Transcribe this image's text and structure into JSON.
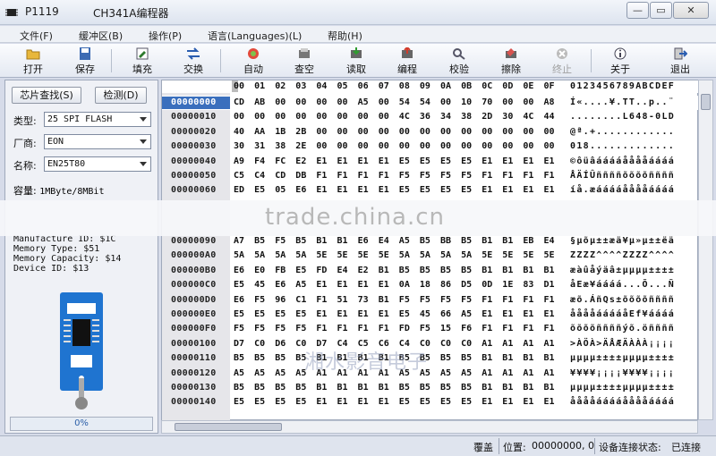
{
  "window": {
    "id": "P1119",
    "title": "CH341A编程器"
  },
  "menu": [
    "文件(F)",
    "缓冲区(B)",
    "操作(P)",
    "语言(Languages)(L)",
    "帮助(H)"
  ],
  "toolbar": [
    {
      "label": "打开",
      "icon": "open-folder-icon"
    },
    {
      "label": "保存",
      "icon": "save-icon"
    },
    {
      "label": "填充",
      "icon": "fill-icon"
    },
    {
      "label": "交换",
      "icon": "swap-icon"
    },
    {
      "label": "自动",
      "icon": "auto-icon"
    },
    {
      "label": "查空",
      "icon": "blank-check-icon"
    },
    {
      "label": "读取",
      "icon": "read-icon"
    },
    {
      "label": "编程",
      "icon": "program-icon"
    },
    {
      "label": "校验",
      "icon": "verify-icon"
    },
    {
      "label": "擦除",
      "icon": "erase-icon"
    },
    {
      "label": "终止",
      "icon": "stop-icon"
    },
    {
      "label": "关于",
      "icon": "about-icon"
    },
    {
      "label": "退出",
      "icon": "exit-icon"
    }
  ],
  "left": {
    "find_chip": "芯片查找(S)",
    "detect": "检测(D)",
    "type_label": "类型:",
    "type_value": "25 SPI FLASH",
    "vendor_label": "厂商:",
    "vendor_value": "EON",
    "name_label": "名称:",
    "name_value": "EN25T80",
    "capacity_label": "容量:",
    "capacity_value": "1MByte/8MBit",
    "info": [
      "Manufacture ID: $1C",
      "Memory Type: $51",
      "Memory Capacity: $14",
      "Device ID: $13"
    ],
    "progress": "0%"
  },
  "hex": {
    "header_cols": [
      "00",
      "01",
      "02",
      "03",
      "04",
      "05",
      "06",
      "07",
      "08",
      "09",
      "0A",
      "0B",
      "0C",
      "0D",
      "0E",
      "0F"
    ],
    "ascii_header": "0123456789ABCDEF",
    "rows_top": [
      {
        "addr": "00000000",
        "bytes": [
          "CD",
          "AB",
          "00",
          "00",
          "00",
          "00",
          "A5",
          "00",
          "54",
          "54",
          "00",
          "10",
          "70",
          "00",
          "00",
          "A8"
        ],
        "ascii": "Í«....¥.TT..p..¨"
      },
      {
        "addr": "00000010",
        "bytes": [
          "00",
          "00",
          "00",
          "00",
          "00",
          "00",
          "00",
          "00",
          "4C",
          "36",
          "34",
          "38",
          "2D",
          "30",
          "4C",
          "44"
        ],
        "ascii": "........L648-0LD"
      },
      {
        "addr": "00000020",
        "bytes": [
          "40",
          "AA",
          "1B",
          "2B",
          "00",
          "00",
          "00",
          "00",
          "00",
          "00",
          "00",
          "00",
          "00",
          "00",
          "00",
          "00"
        ],
        "ascii": "@ª.+............"
      },
      {
        "addr": "00000030",
        "bytes": [
          "30",
          "31",
          "38",
          "2E",
          "00",
          "00",
          "00",
          "00",
          "00",
          "00",
          "00",
          "00",
          "00",
          "00",
          "00",
          "00"
        ],
        "ascii": "018............."
      },
      {
        "addr": "00000040",
        "bytes": [
          "A9",
          "F4",
          "FC",
          "E2",
          "E1",
          "E1",
          "E1",
          "E1",
          "E5",
          "E5",
          "E5",
          "E5",
          "E1",
          "E1",
          "E1",
          "E1"
        ],
        "ascii": "©ôüâááááååååáááá"
      },
      {
        "addr": "00000050",
        "bytes": [
          "C5",
          "C4",
          "CD",
          "DB",
          "F1",
          "F1",
          "F1",
          "F1",
          "F5",
          "F5",
          "F5",
          "F5",
          "F1",
          "F1",
          "F1",
          "F1"
        ],
        "ascii": "ÅÄÍÛññññõõõõññññ"
      },
      {
        "addr": "00000060",
        "bytes": [
          "ED",
          "E5",
          "05",
          "E6",
          "E1",
          "E1",
          "E1",
          "E1",
          "E5",
          "E5",
          "E5",
          "E5",
          "E1",
          "E1",
          "E1",
          "E1"
        ],
        "ascii": "íå.æááááååååáááá"
      }
    ],
    "rows_bottom": [
      {
        "addr": "00000090",
        "bytes": [
          "A7",
          "B5",
          "F5",
          "B5",
          "B1",
          "B1",
          "E6",
          "E4",
          "A5",
          "B5",
          "BB",
          "B5",
          "B1",
          "B1",
          "EB",
          "E4"
        ],
        "ascii": "§µõµ±±æä¥µ»µ±±ëä"
      },
      {
        "addr": "000000A0",
        "bytes": [
          "5A",
          "5A",
          "5A",
          "5A",
          "5E",
          "5E",
          "5E",
          "5E",
          "5A",
          "5A",
          "5A",
          "5A",
          "5E",
          "5E",
          "5E",
          "5E"
        ],
        "ascii": "ZZZZ^^^^ZZZZ^^^^"
      },
      {
        "addr": "000000B0",
        "bytes": [
          "E6",
          "E0",
          "FB",
          "E5",
          "FD",
          "E4",
          "E2",
          "B1",
          "B5",
          "B5",
          "B5",
          "B5",
          "B1",
          "B1",
          "B1",
          "B1"
        ],
        "ascii": "æàûåýäâ±µµµµ±±±±"
      },
      {
        "addr": "000000C0",
        "bytes": [
          "E5",
          "45",
          "E6",
          "A5",
          "E1",
          "E1",
          "E1",
          "E1",
          "0A",
          "18",
          "86",
          "D5",
          "0D",
          "1E",
          "83",
          "D1"
        ],
        "ascii": "åEæ¥áááá...Õ...Ñ"
      },
      {
        "addr": "000000D0",
        "bytes": [
          "E6",
          "F5",
          "96",
          "C1",
          "F1",
          "51",
          "73",
          "B1",
          "F5",
          "F5",
          "F5",
          "F5",
          "F1",
          "F1",
          "F1",
          "F1"
        ],
        "ascii": "æõ.ÁñQs±õõõõññññ"
      },
      {
        "addr": "000000E0",
        "bytes": [
          "E5",
          "E5",
          "E5",
          "E5",
          "E1",
          "E1",
          "E1",
          "E1",
          "E5",
          "45",
          "66",
          "A5",
          "E1",
          "E1",
          "E1",
          "E1"
        ],
        "ascii": "ååååááááåEf¥áááá"
      },
      {
        "addr": "000000F0",
        "bytes": [
          "F5",
          "F5",
          "F5",
          "F5",
          "F1",
          "F1",
          "F1",
          "F1",
          "FD",
          "F5",
          "15",
          "F6",
          "F1",
          "F1",
          "F1",
          "F1"
        ],
        "ascii": "õõõõññññýõ.öññññ"
      },
      {
        "addr": "00000100",
        "bytes": [
          "D7",
          "C0",
          "D6",
          "C0",
          "D7",
          "C4",
          "C5",
          "C6",
          "C4",
          "C0",
          "C0",
          "C0",
          "A1",
          "A1",
          "A1",
          "A1"
        ],
        "ascii": ">ÀÖÀ>ÄÅÆÄÀÀÀ¡¡¡¡"
      },
      {
        "addr": "00000110",
        "bytes": [
          "B5",
          "B5",
          "B5",
          "B5",
          "B1",
          "B1",
          "B1",
          "B1",
          "B5",
          "B5",
          "B5",
          "B5",
          "B1",
          "B1",
          "B1",
          "B1"
        ],
        "ascii": "µµµµ±±±±µµµµ±±±±"
      },
      {
        "addr": "00000120",
        "bytes": [
          "A5",
          "A5",
          "A5",
          "A5",
          "A1",
          "A1",
          "A1",
          "A1",
          "A5",
          "A5",
          "A5",
          "A5",
          "A1",
          "A1",
          "A1",
          "A1"
        ],
        "ascii": "¥¥¥¥¡¡¡¡¥¥¥¥¡¡¡¡"
      },
      {
        "addr": "00000130",
        "bytes": [
          "B5",
          "B5",
          "B5",
          "B5",
          "B1",
          "B1",
          "B1",
          "B1",
          "B5",
          "B5",
          "B5",
          "B5",
          "B1",
          "B1",
          "B1",
          "B1"
        ],
        "ascii": "µµµµ±±±±µµµµ±±±±"
      },
      {
        "addr": "00000140",
        "bytes": [
          "E5",
          "E5",
          "E5",
          "E5",
          "E1",
          "E1",
          "E1",
          "E1",
          "E5",
          "E5",
          "E5",
          "E5",
          "E1",
          "E1",
          "E1",
          "E1"
        ],
        "ascii": "ååååááááååååáááá"
      }
    ]
  },
  "watermark": "trade.china.cn",
  "watermark2": "湘水影音电子",
  "status": {
    "mode": "覆盖",
    "pos_label": "位置:",
    "pos_value": "00000000, 0",
    "conn_label": "设备连接状态:",
    "conn_value": "已连接"
  }
}
